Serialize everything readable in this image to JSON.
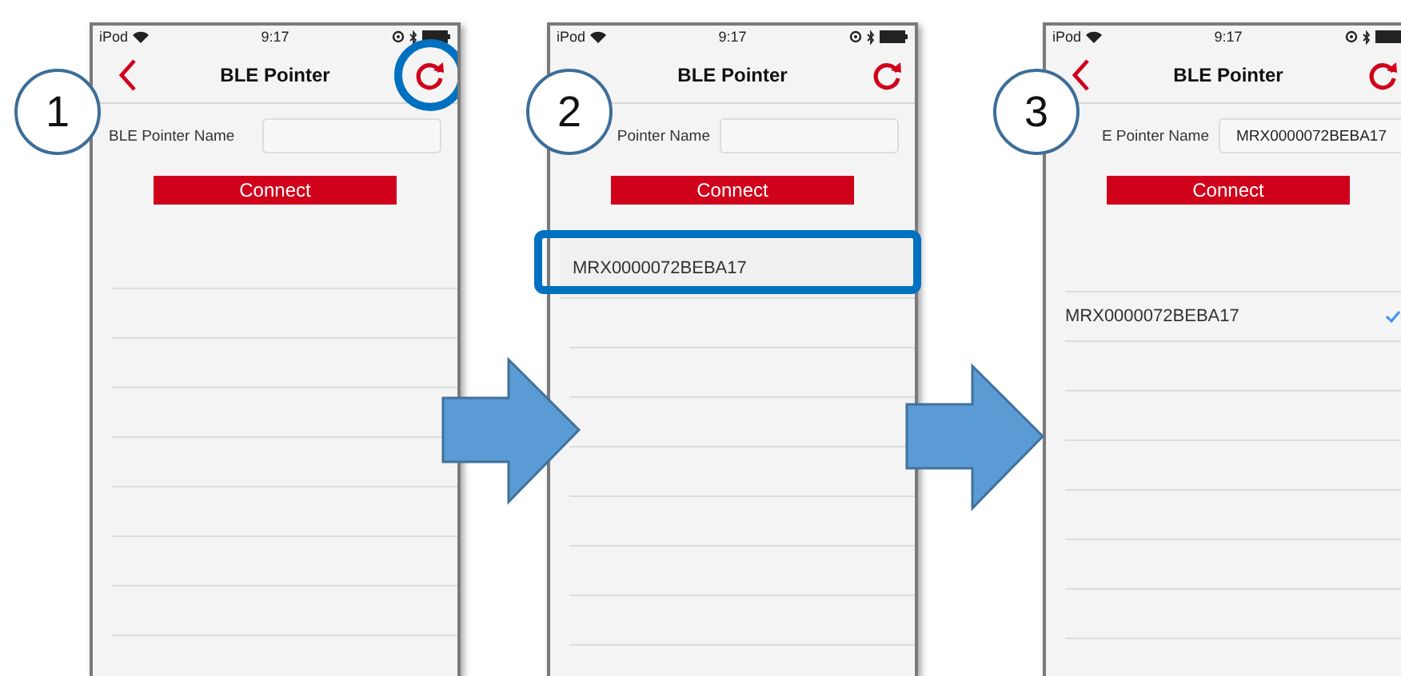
{
  "panels": [
    {
      "callout": "1",
      "status": {
        "carrier": "iPod",
        "time": "9:17"
      },
      "back_visible": true,
      "title": "BLE Pointer",
      "refresh_highlighted": true,
      "field_label": "BLE Pointer Name",
      "button": "Connect"
    },
    {
      "callout": "2",
      "status": {
        "carrier": "iPod",
        "time": "9:17"
      },
      "back_visible": false,
      "title": "BLE Pointer",
      "refresh_highlighted": false,
      "field_label": "Pointer Name",
      "button": "Connect",
      "devices": [
        {
          "name": "MRX0000072BEBA17",
          "selected": false,
          "highlighted": true
        }
      ]
    },
    {
      "callout": "3",
      "status": {
        "carrier": "iPod",
        "time": "9:17"
      },
      "back_visible": true,
      "title": "BLE Pointer",
      "refresh_highlighted": false,
      "field_label": "E Pointer Name",
      "field_value": "MRX0000072BEBA17",
      "button": "Connect",
      "devices": [
        {
          "name": "MRX0000072BEBA17",
          "selected": true,
          "highlighted": false
        }
      ]
    }
  ]
}
